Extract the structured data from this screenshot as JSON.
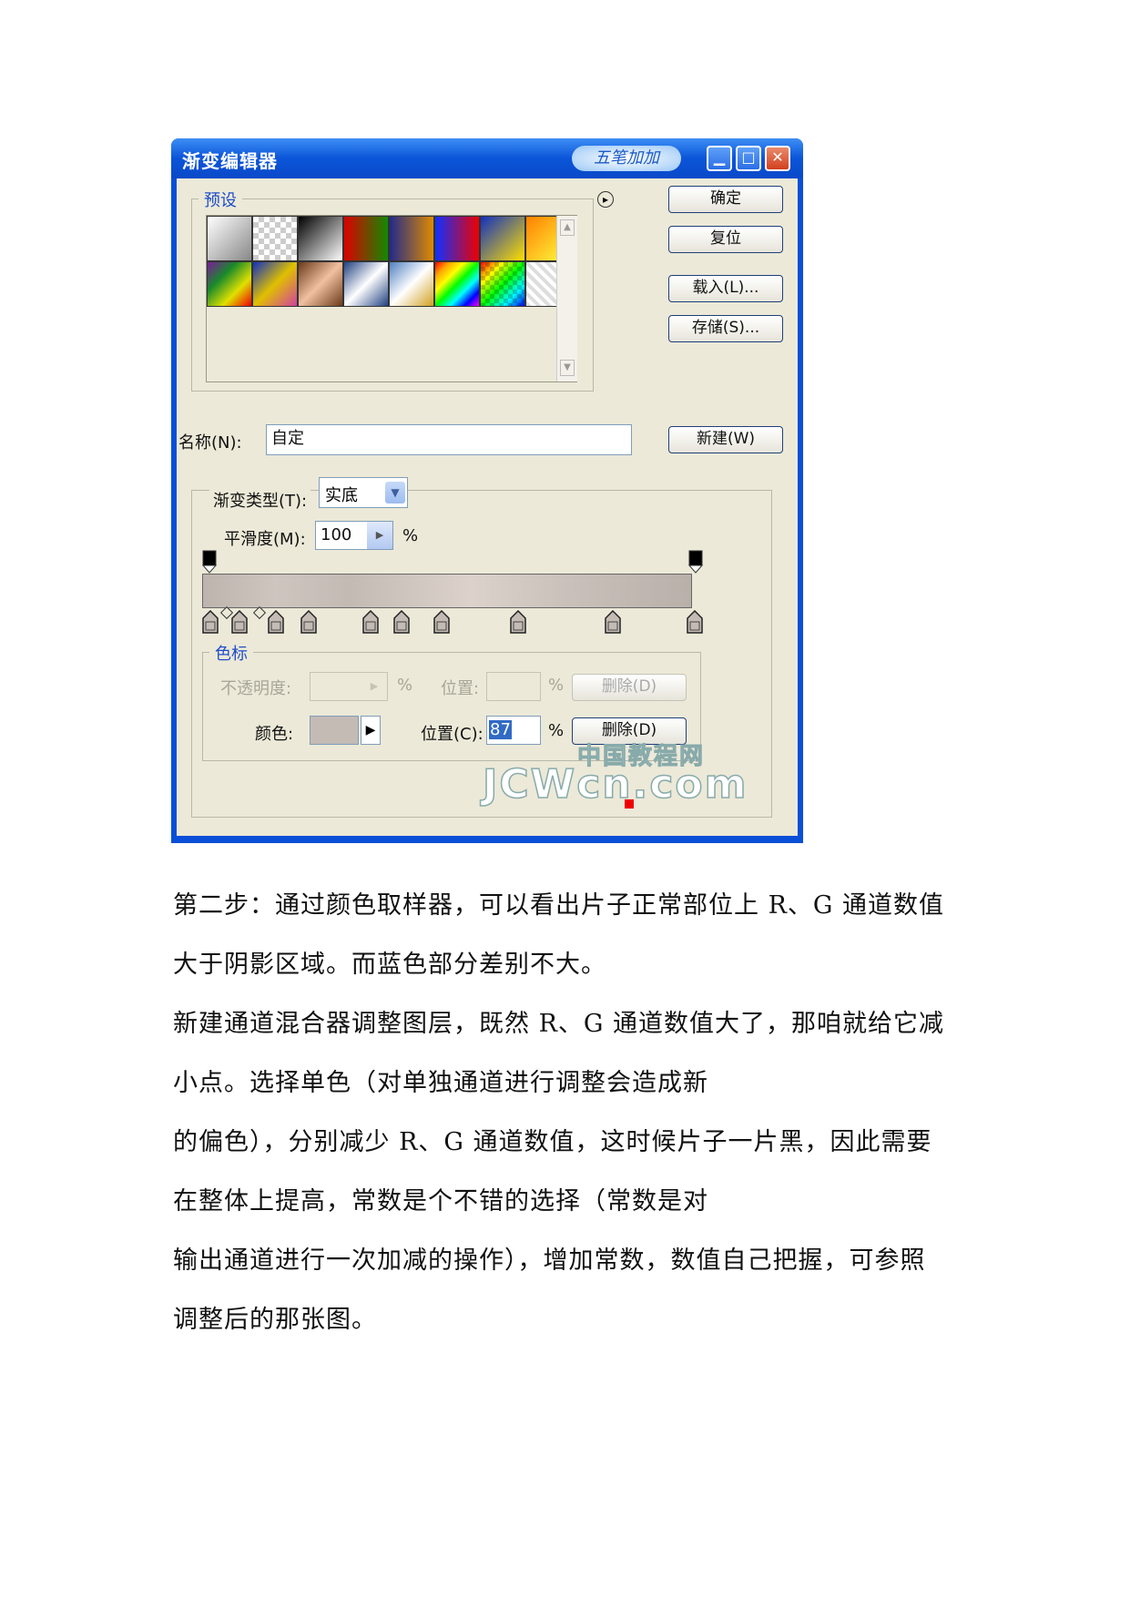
{
  "dialog": {
    "title": "渐变编辑器",
    "logo_text": "五笔加加",
    "minimize_icon": "▁",
    "maximize_icon": "□",
    "close_icon": "✕",
    "presets_label": "预设",
    "menu_arrow": "▸",
    "buttons": {
      "ok": "确定",
      "reset": "复位",
      "load": "载入(L)...",
      "save": "存储(S)...",
      "new": "新建(W)"
    },
    "name_label": "名称(N):",
    "name_value": "自定",
    "gradient_type_label": "渐变类型(T):",
    "gradient_type_value": "实底",
    "smoothness_label": "平滑度(M):",
    "smoothness_value": "100",
    "percent": "%",
    "stops_label": "色标",
    "opacity_label": "不透明度:",
    "location_label_disabled": "位置:",
    "delete_label": "删除(D)",
    "color_label": "颜色:",
    "location_label": "位置(C):",
    "location_value": "87",
    "watermark_cn": "中国教程网",
    "watermark_en": "JCWcn.com"
  },
  "paragraphs": [
    "第二步：通过颜色取样器，可以看出片子正常部位上 R、G 通道数值",
    "大于阴影区域。而蓝色部分差别不大。",
    "新建通道混合器调整图层，既然 R、G 通道数值大了，那咱就给它减",
    "小点。选择单色（对单独通道进行调整会造成新",
    "的偏色），分别减少 R、G 通道数值，这时候片子一片黑，因此需要",
    "在整体上提高，常数是个不错的选择（常数是对",
    "输出通道进行一次加减的操作），增加常数，数值自己把握，可参照",
    "调整后的那张图。"
  ],
  "colors": {
    "titlebar": "#0b55d9",
    "dialog_bg": "#ece9d8",
    "gradient_bar": "#c4bbb5"
  }
}
